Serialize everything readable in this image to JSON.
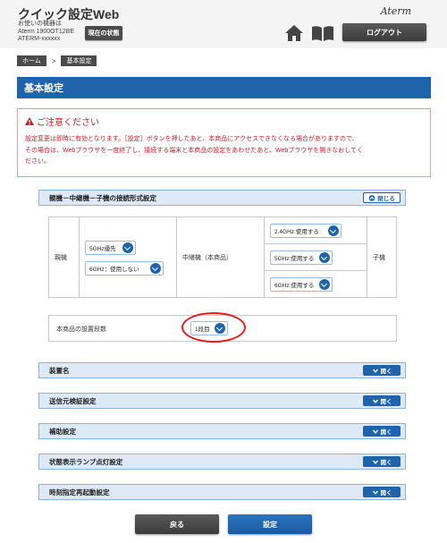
{
  "header": {
    "app_title": "クイック設定Web",
    "model_label": "お使いの機器は",
    "model_name": "Aterm 1900OT12BE",
    "device_id": "ATERM-xxxxxx",
    "status_button": "現在の状態",
    "brand": "Aterm",
    "home_icon": "home-icon",
    "manual_icon": "manual-book-icon",
    "logout_button": "ログアウト"
  },
  "breadcrumb": {
    "home": "ホーム",
    "separator": ">",
    "current": "基本設定"
  },
  "page_title": "基本設定",
  "notice": {
    "title": "ご注意ください",
    "line1": "設定変更は即時に有効となります。［設定］ボタンを押したあと、本商品にアクセスできなくなる場合がありますので、",
    "line2": "その場合は、Webブラウザを一度終了し、接続する端末と本商品の設定をあわせたあと、Webブラウザを開きなおしてく",
    "line3": "ださい。"
  },
  "connection": {
    "section_title": "親機－中継機－子機の接続形式設定",
    "toggle_label": "閉じる",
    "parent_label": "親機",
    "parent_band": "5GHz優先",
    "parent_6ghz": "6GHz：使用しない",
    "repeater_label": "中継機（本商品）",
    "repeater_24": "2.4GHz:使用する",
    "repeater_5": "5GHz:使用する",
    "repeater_6": "6GHz:使用する",
    "child_label": "子機"
  },
  "stage": {
    "label": "本商品の設置段数",
    "value": "1段目"
  },
  "sections": [
    {
      "title": "装置名",
      "toggle": "開く"
    },
    {
      "title": "送信元検証設定",
      "toggle": "開く"
    },
    {
      "title": "補助設定",
      "toggle": "開く"
    },
    {
      "title": "状態表示ランプ点灯設定",
      "toggle": "開く"
    },
    {
      "title": "時刻指定再起動設定",
      "toggle": "開く"
    }
  ],
  "buttons": {
    "back": "戻る",
    "set": "設定"
  },
  "colors": {
    "primary": "#1f64ab",
    "warning": "#c0202c",
    "highlight": "#e21b1b",
    "dark_button": "#4b4b4b"
  }
}
